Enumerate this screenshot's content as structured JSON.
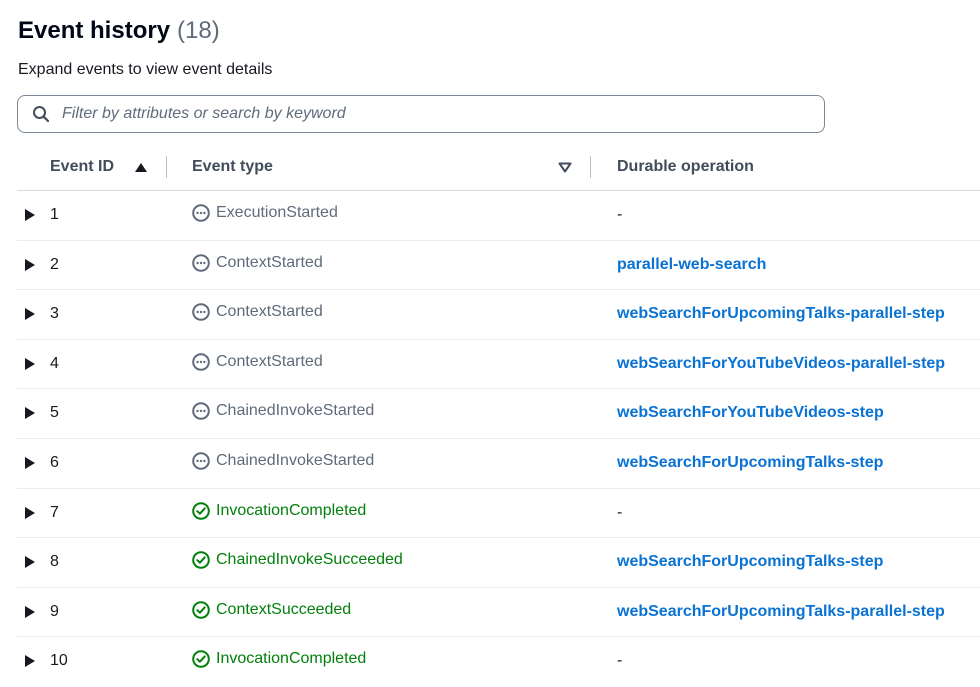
{
  "header": {
    "title": "Event history",
    "count": "(18)",
    "subtitle": "Expand events to view event details"
  },
  "search": {
    "placeholder": "Filter by attributes or search by keyword",
    "value": ""
  },
  "columns": {
    "event_id": "Event ID",
    "event_type": "Event type",
    "durable_operation": "Durable operation"
  },
  "colors": {
    "link": "#0972d3",
    "success": "#037f0c",
    "neutral": "#5f6b7a"
  },
  "rows": [
    {
      "id": "1",
      "type": "ExecutionStarted",
      "status": "neutral",
      "operation": "-",
      "is_link": false
    },
    {
      "id": "2",
      "type": "ContextStarted",
      "status": "neutral",
      "operation": "parallel-web-search",
      "is_link": true
    },
    {
      "id": "3",
      "type": "ContextStarted",
      "status": "neutral",
      "operation": "webSearchForUpcomingTalks-parallel-step",
      "is_link": true
    },
    {
      "id": "4",
      "type": "ContextStarted",
      "status": "neutral",
      "operation": "webSearchForYouTubeVideos-parallel-step",
      "is_link": true
    },
    {
      "id": "5",
      "type": "ChainedInvokeStarted",
      "status": "neutral",
      "operation": "webSearchForYouTubeVideos-step",
      "is_link": true
    },
    {
      "id": "6",
      "type": "ChainedInvokeStarted",
      "status": "neutral",
      "operation": "webSearchForUpcomingTalks-step",
      "is_link": true
    },
    {
      "id": "7",
      "type": "InvocationCompleted",
      "status": "success",
      "operation": "-",
      "is_link": false
    },
    {
      "id": "8",
      "type": "ChainedInvokeSucceeded",
      "status": "success",
      "operation": "webSearchForUpcomingTalks-step",
      "is_link": true
    },
    {
      "id": "9",
      "type": "ContextSucceeded",
      "status": "success",
      "operation": "webSearchForUpcomingTalks-parallel-step",
      "is_link": true
    },
    {
      "id": "10",
      "type": "InvocationCompleted",
      "status": "success",
      "operation": "-",
      "is_link": false
    }
  ]
}
